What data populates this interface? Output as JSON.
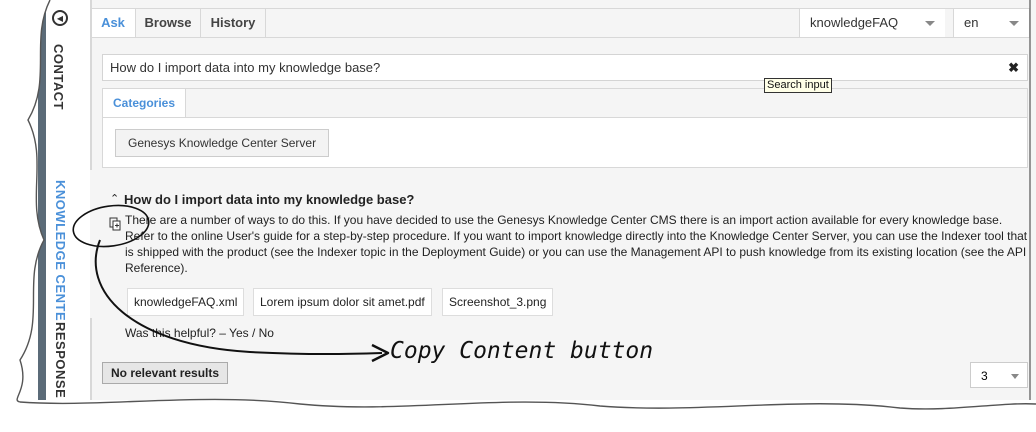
{
  "sidebar": {
    "tabs": [
      {
        "label": "CONTACT"
      },
      {
        "label": "KNOWLEDGE CENTE"
      },
      {
        "label": "RESPONSE"
      }
    ]
  },
  "tabs": [
    {
      "label": "Ask"
    },
    {
      "label": "Browse"
    },
    {
      "label": "History"
    }
  ],
  "kb_select": {
    "value": "knowledgeFAQ"
  },
  "lang_select": {
    "value": "en"
  },
  "search": {
    "value": "How do I import data into my knowledge base?",
    "tooltip": "Search input"
  },
  "categories": {
    "tab_label": "Categories",
    "items": [
      "Genesys Knowledge Center Server"
    ]
  },
  "result": {
    "title": "How do I import data into my knowledge base?",
    "body": "There are a number of ways to do this. If you have decided to use the Genesys Knowledge Center CMS there is an import action available for every knowledge base. Refer to the online User's guide for a step-by-step procedure. If you want to import knowledge directly into the Knowledge Center Server, you can use the Indexer tool that is shipped with the product (see the Indexer topic in the Deployment Guide) or you can use the Management API to push knowledge from its existing location (see the API Reference).",
    "attachments": [
      "knowledgeFAQ.xml",
      "Lorem ipsum dolor sit amet.pdf",
      "Screenshot_3.png"
    ],
    "helpful_prompt": "Was this helpful? – Yes / No"
  },
  "no_relevant_label": "No relevant results",
  "pager": {
    "value": "3"
  },
  "annotation": "Copy Content button",
  "colors": {
    "accent": "#4a90d9",
    "sidebar_strip": "#5b6b78"
  }
}
